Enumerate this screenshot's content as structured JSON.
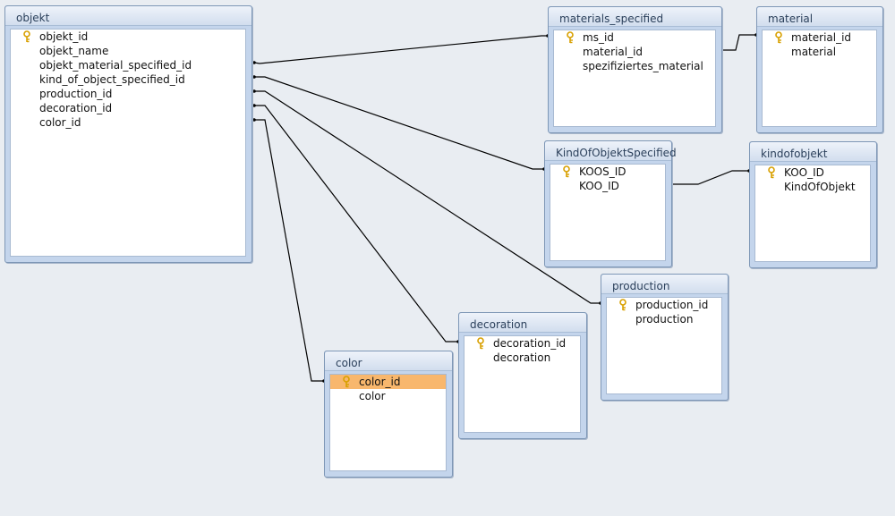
{
  "tables": {
    "objekt": {
      "title": "objekt",
      "fields": [
        "objekt_id",
        "objekt_name",
        "objekt_material_specified_id",
        "kind_of_object_specified_id",
        "production_id",
        "decoration_id",
        "color_id"
      ]
    },
    "materials_specified": {
      "title": "materials_specified",
      "fields": [
        "ms_id",
        "material_id",
        "spezifiziertes_material"
      ]
    },
    "material": {
      "title": "material",
      "fields": [
        "material_id",
        "material"
      ]
    },
    "kind_of_objekt_specified": {
      "title": "KindOfObjektSpecified",
      "fields": [
        "KOOS_ID",
        "KOO_ID"
      ]
    },
    "kindofobjekt": {
      "title": "kindofobjekt",
      "fields": [
        "KOO_ID",
        "KindOfObjekt"
      ]
    },
    "production": {
      "title": "production",
      "fields": [
        "production_id",
        "production"
      ]
    },
    "decoration": {
      "title": "decoration",
      "fields": [
        "decoration_id",
        "decoration"
      ]
    },
    "color": {
      "title": "color",
      "fields": [
        "color_id",
        "color"
      ]
    }
  },
  "selection": {
    "table": "color",
    "field": "color_id"
  },
  "colors": {
    "selected_row": "#f8b76d",
    "relationship_line": "#000000",
    "key_icon": "#d8a000"
  },
  "icons": {
    "primary_key": "key-icon"
  }
}
